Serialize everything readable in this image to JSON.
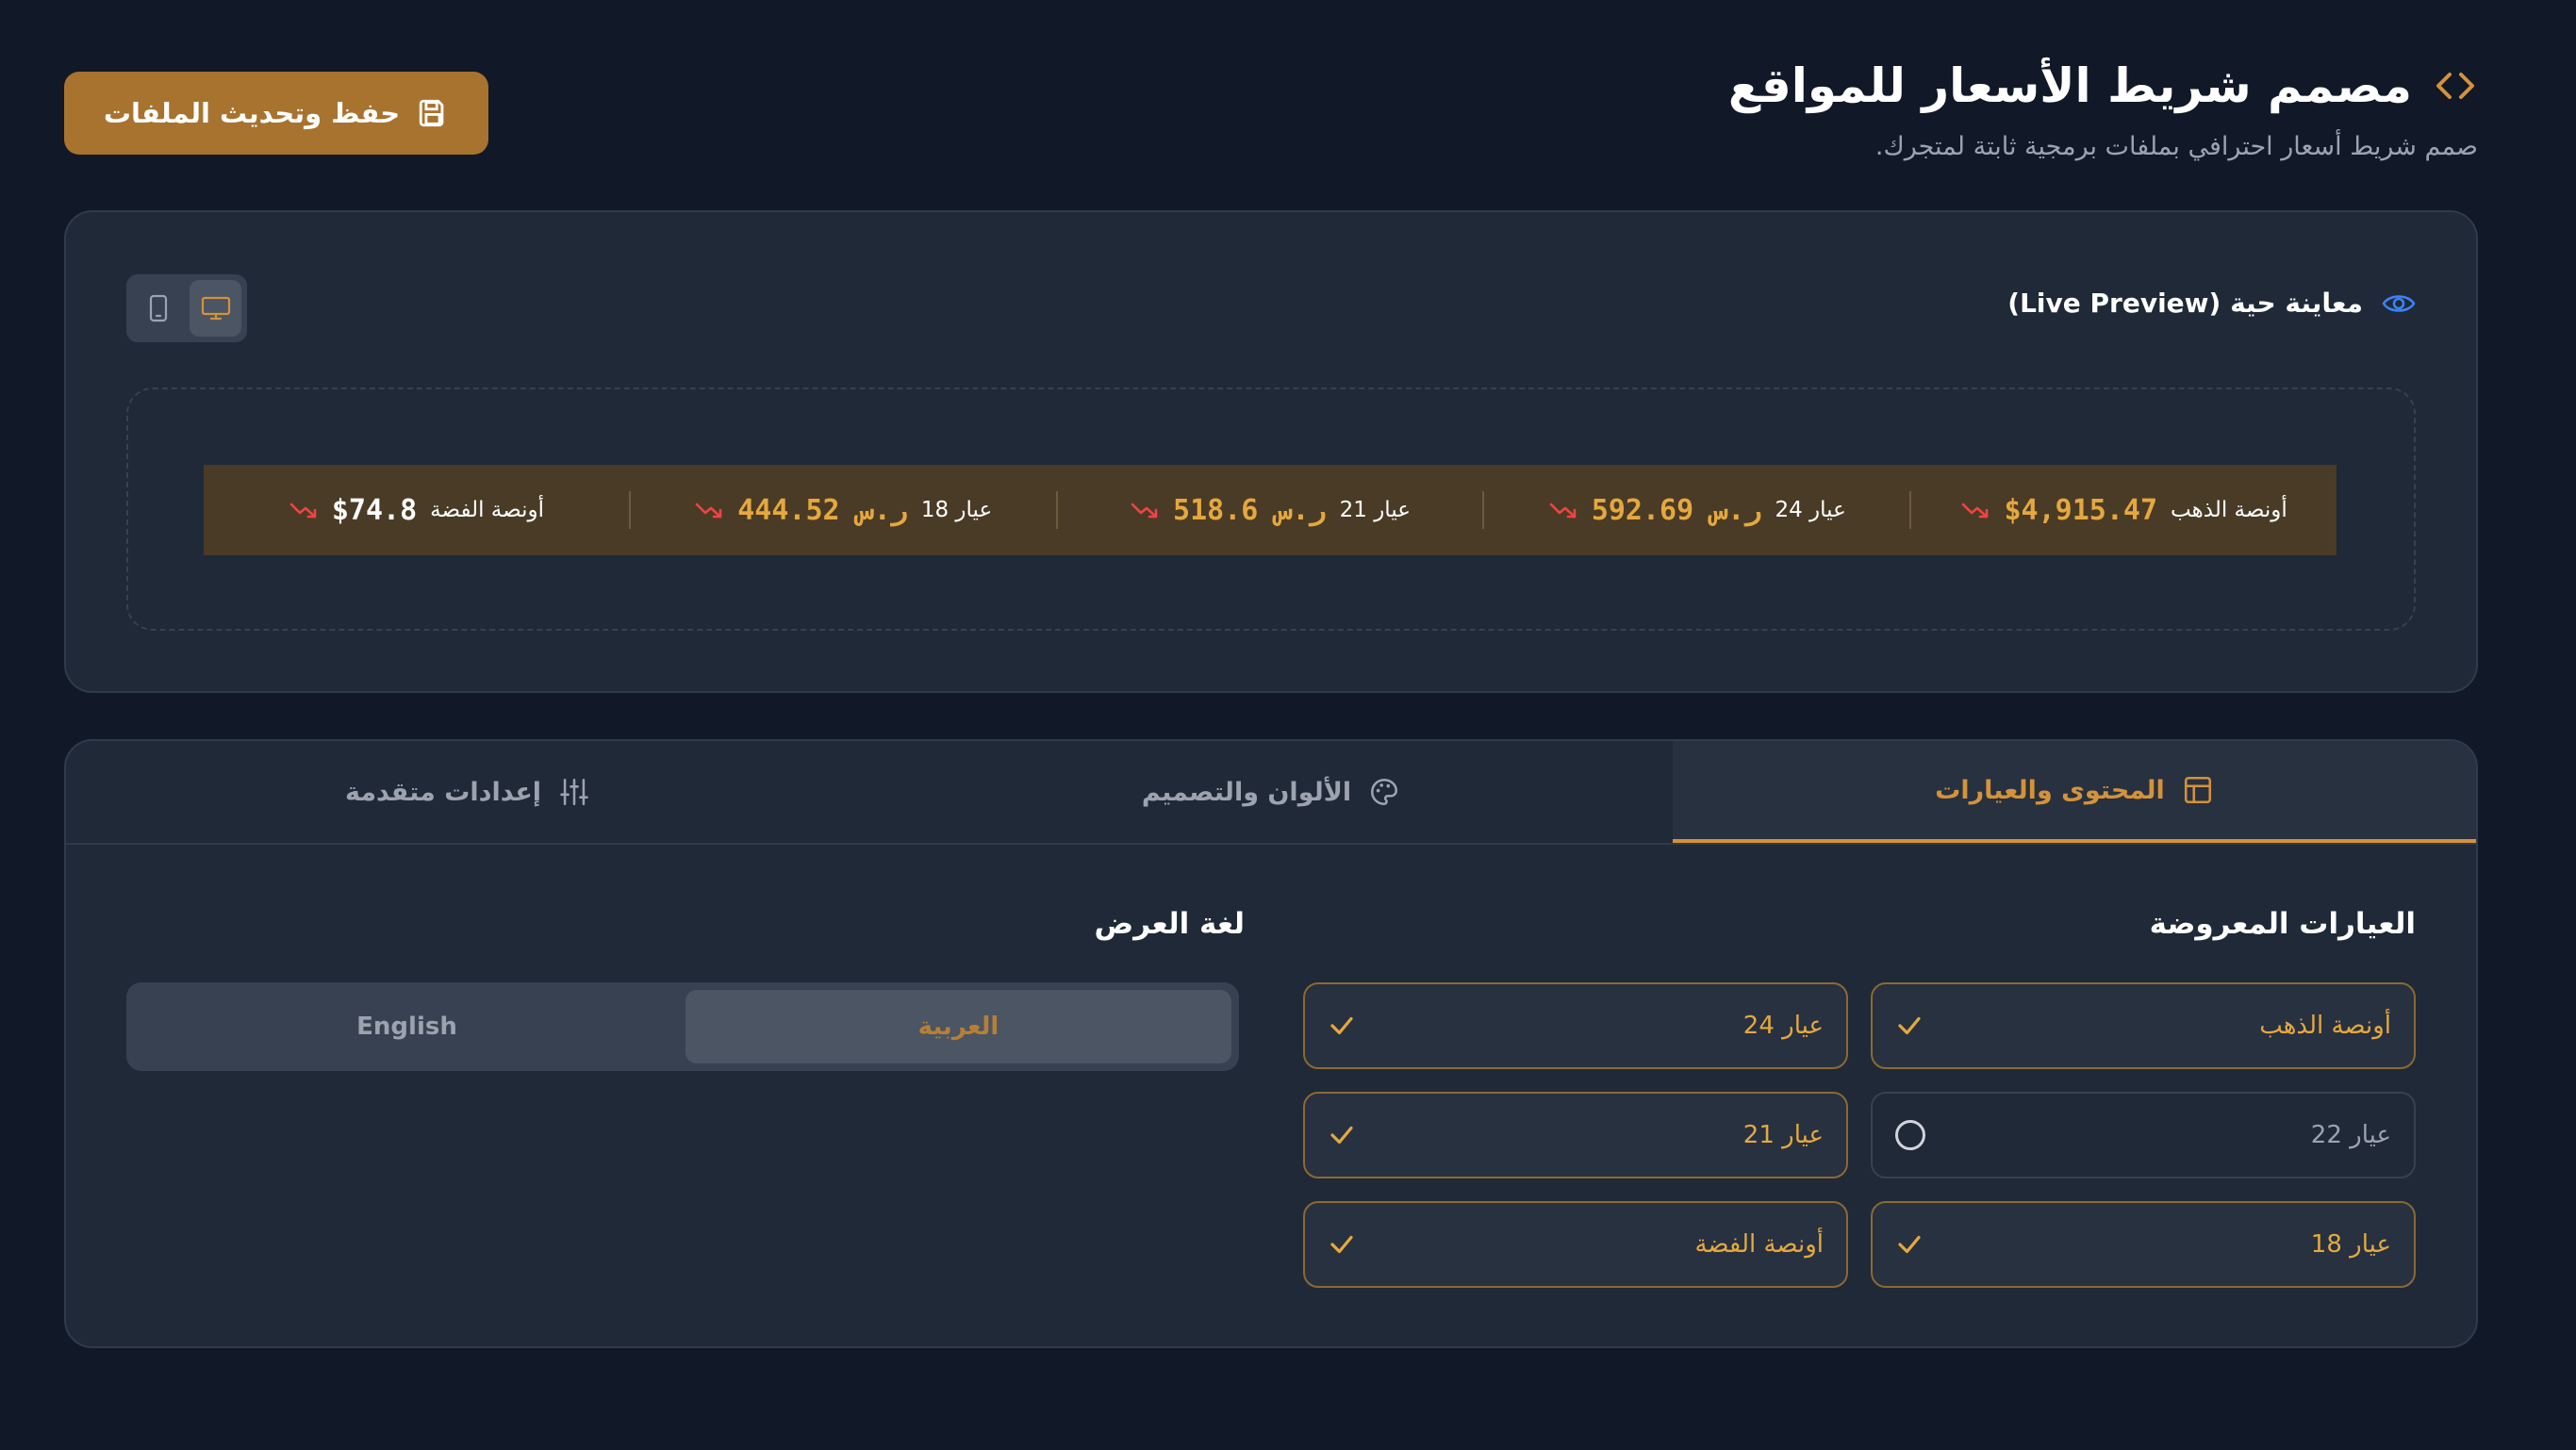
{
  "header": {
    "title": "مصمم شريط الأسعار للمواقع",
    "subtitle": "صمم شريط أسعار احترافي بملفات برمجية ثابتة لمتجرك.",
    "save_label": "حفظ وتحديث الملفات"
  },
  "preview": {
    "title": "معاينة حية (Live Preview)",
    "device_modes": [
      "desktop",
      "mobile"
    ],
    "active_device": "desktop",
    "ticker": [
      {
        "name": "أونصة الذهب",
        "price": "$4,915.47",
        "trend": "down",
        "price_color": "#e5a83f"
      },
      {
        "name": "عيار 24",
        "price": "592.69 ر.س",
        "trend": "down",
        "price_color": "#e5a83f"
      },
      {
        "name": "عيار 21",
        "price": "518.6 ر.س",
        "trend": "down",
        "price_color": "#e5a83f"
      },
      {
        "name": "عيار 18",
        "price": "444.52 ر.س",
        "trend": "down",
        "price_color": "#e5a83f"
      },
      {
        "name": "أونصة الفضة",
        "price": "$74.8",
        "trend": "down",
        "price_color": "#ffffff"
      }
    ]
  },
  "tabs": [
    {
      "label": "المحتوى والعيارات",
      "icon": "layout-icon",
      "active": true
    },
    {
      "label": "الألوان والتصميم",
      "icon": "palette-icon",
      "active": false
    },
    {
      "label": "إعدادات متقدمة",
      "icon": "sliders-icon",
      "active": false
    }
  ],
  "options_section": {
    "title": "العيارات المعروضة",
    "items": [
      {
        "label": "أونصة الذهب",
        "checked": true
      },
      {
        "label": "عيار 24",
        "checked": true
      },
      {
        "label": "عيار 22",
        "checked": false
      },
      {
        "label": "عيار 21",
        "checked": true
      },
      {
        "label": "عيار 18",
        "checked": true
      },
      {
        "label": "أونصة الفضة",
        "checked": true
      }
    ]
  },
  "language_section": {
    "title": "لغة العرض",
    "options": [
      "العربية",
      "English"
    ],
    "selected": "العربية"
  },
  "colors": {
    "accent": "#a8732e",
    "price_gold": "#e5a83f",
    "trend_down": "#ef4444",
    "ticker_bg": "#4a3b26"
  }
}
